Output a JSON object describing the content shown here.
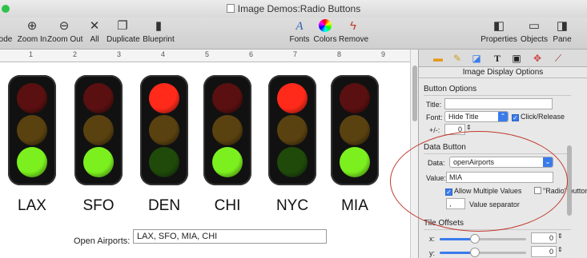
{
  "window": {
    "title": "Image Demos:Radio Buttons"
  },
  "toolbar": {
    "mode_label": "ode",
    "zoom_in": "Zoom In",
    "zoom_out": "Zoom Out",
    "all": "All",
    "duplicate": "Duplicate",
    "blueprint": "Blueprint",
    "fonts": "Fonts",
    "colors": "Colors",
    "remove": "Remove",
    "properties": "Properties",
    "objects": "Objects",
    "pane": "Pane"
  },
  "ruler": {
    "marks": [
      "1",
      "2",
      "3",
      "4",
      "5",
      "6",
      "7",
      "8",
      "9"
    ]
  },
  "airports": [
    {
      "code": "LAX",
      "state": "green"
    },
    {
      "code": "SFO",
      "state": "green"
    },
    {
      "code": "DEN",
      "state": "red"
    },
    {
      "code": "CHI",
      "state": "green"
    },
    {
      "code": "NYC",
      "state": "red"
    },
    {
      "code": "MIA",
      "state": "green"
    }
  ],
  "open_airports": {
    "label": "Open Airports:",
    "value": "LAX, SFO, MIA, CHI"
  },
  "colors": {
    "accent": "#3a7bea",
    "red_on": "#ff2a1a",
    "red_off": "#5a1010",
    "amber_off": "#5a4210",
    "green_on": "#7cf01e",
    "green_off": "#1f4a0a",
    "circle": "#c0392b"
  },
  "inspector": {
    "title": "Image Display Options",
    "button_options": {
      "heading": "Button Options",
      "title_label": "Title:",
      "title_value": "",
      "font_label": "Font:",
      "font_value": "Hide Title",
      "click_release": "Click/Release",
      "plus_minus_label": "+/-:",
      "plus_minus_value": "0"
    },
    "data_button": {
      "heading": "Data Button",
      "data_label": "Data:",
      "data_value": "openAirports",
      "value_label": "Value:",
      "value_value": "MIA",
      "allow_multiple": "Allow Multiple Values",
      "radio_button": "\"Radio\" button",
      "separator_value": ",",
      "separator_label": "Value separator"
    },
    "tile_offsets": {
      "heading": "Tile Offsets",
      "x_label": "x:",
      "x_value": "0",
      "y_label": "y:",
      "y_value": "0"
    }
  }
}
